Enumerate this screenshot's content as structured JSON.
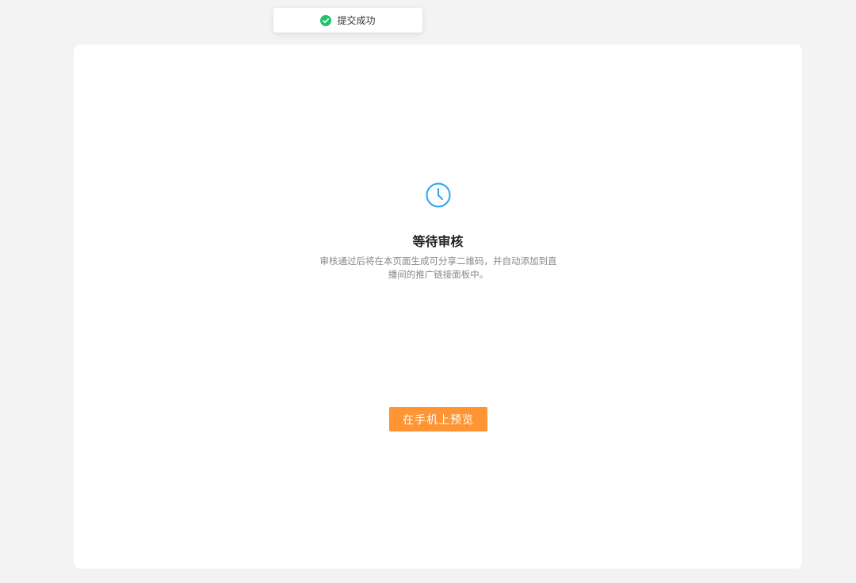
{
  "toast": {
    "icon": "check-circle-icon",
    "message": "提交成功",
    "color": "#23c26b"
  },
  "status": {
    "icon": "clock-icon",
    "icon_color": "#2aa6f0",
    "title": "等待审核",
    "description": "审核通过后将在本页面生成可分享二维码，并自动添加到直播间的推广链接面板中。"
  },
  "actions": {
    "preview_label": "在手机上预览",
    "preview_color": "#ff9433"
  }
}
